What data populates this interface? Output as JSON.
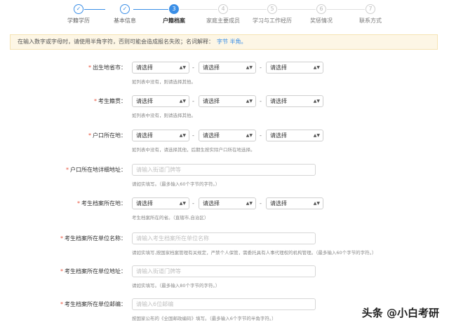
{
  "steps": [
    {
      "num": "✓",
      "label": "学籍学历",
      "state": "done"
    },
    {
      "num": "✓",
      "label": "基本信息",
      "state": "done"
    },
    {
      "num": "3",
      "label": "户籍档案",
      "state": "active"
    },
    {
      "num": "4",
      "label": "家庭主要成员",
      "state": "pending"
    },
    {
      "num": "5",
      "label": "学习与工作经历",
      "state": "pending"
    },
    {
      "num": "6",
      "label": "奖惩情况",
      "state": "pending"
    },
    {
      "num": "7",
      "label": "联系方式",
      "state": "pending"
    }
  ],
  "notice": {
    "text": "在输入数字或字母时，请使用半角字符，否则可能会造成报名失败；名词解释：",
    "link": "字节 半角。"
  },
  "select_placeholder": "请选择",
  "dash": "-",
  "fields": {
    "birthplace": {
      "label": "出生地省市：",
      "hint": "如列表中没有，则请选择其他。"
    },
    "native": {
      "label": "考生籍贯：",
      "hint": "如列表中没有，则请选择其他。"
    },
    "hukou": {
      "label": "户口所在地：",
      "hint": "如列表中没有，请选择其他，后期生按实际户口所在地选择。"
    },
    "hukou_addr": {
      "label": "户口所在地详细地址：",
      "placeholder": "请输入街道门牌等",
      "hint": "请如实填写。（最多输入60个字节的字符。）"
    },
    "archive_loc": {
      "label": "考生档案所在地：",
      "hint": "考生档案所在的省。（直辖市,自治区）"
    },
    "archive_unit": {
      "label": "考生档案所在单位名称：",
      "placeholder": "请输入考生档案所在单位名称",
      "hint": "请如实填写,按国家档案管理有关规定，严禁个人保管，需委托具有人事代理权的机构管理。（最多输入60个字节的字符。）"
    },
    "archive_addr": {
      "label": "考生档案所在单位地址：",
      "placeholder": "请输入街道门牌等",
      "hint": "请如实填写。（最多输入80个字节的字符。）"
    },
    "archive_zip": {
      "label": "考生档案所在单位邮编：",
      "placeholder": "请输入6位邮编",
      "hint": "按国家公布的《全国邮政编码》填写。（最多输入6个字节的半角字符。）"
    }
  },
  "watermark": "头条 @小白考研"
}
